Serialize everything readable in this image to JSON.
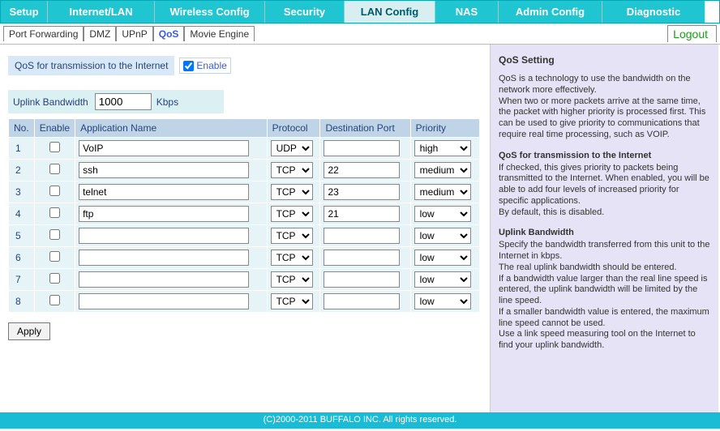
{
  "nav": {
    "setup": "Setup",
    "internet": "Internet/LAN",
    "wireless": "Wireless Config",
    "security": "Security",
    "lan": "LAN Config",
    "nas": "NAS",
    "admin": "Admin Config",
    "diagnostic": "Diagnostic"
  },
  "subnav": {
    "port_forwarding": "Port Forwarding",
    "dmz": "DMZ",
    "upnp": "UPnP",
    "qos": "QoS",
    "movie_engine": "Movie Engine",
    "logout": "Logout"
  },
  "qos": {
    "section_label": "QoS for transmission to the Internet",
    "enable_label": "Enable",
    "uplink_label": "Uplink Bandwidth",
    "uplink_value": "1000",
    "uplink_unit": "Kbps",
    "cols": {
      "no": "No.",
      "enable": "Enable",
      "app": "Application Name",
      "proto": "Protocol",
      "port": "Destination Port",
      "prio": "Priority"
    },
    "rows": [
      {
        "no": "1",
        "app": "VoIP",
        "proto": "UDP",
        "port": "",
        "prio": "high"
      },
      {
        "no": "2",
        "app": "ssh",
        "proto": "TCP",
        "port": "22",
        "prio": "medium"
      },
      {
        "no": "3",
        "app": "telnet",
        "proto": "TCP",
        "port": "23",
        "prio": "medium"
      },
      {
        "no": "4",
        "app": "ftp",
        "proto": "TCP",
        "port": "21",
        "prio": "low"
      },
      {
        "no": "5",
        "app": "",
        "proto": "TCP",
        "port": "",
        "prio": "low"
      },
      {
        "no": "6",
        "app": "",
        "proto": "TCP",
        "port": "",
        "prio": "low"
      },
      {
        "no": "7",
        "app": "",
        "proto": "TCP",
        "port": "",
        "prio": "low"
      },
      {
        "no": "8",
        "app": "",
        "proto": "TCP",
        "port": "",
        "prio": "low"
      }
    ],
    "apply": "Apply"
  },
  "help": {
    "title": "QoS Setting",
    "intro1": "QoS is a technology to use the bandwidth on the network more effectively.",
    "intro2": "When two or more packets arrive at the same time, the packet with higher priority is processed first. This can be used to give priority to communications that require real time processing, such as VOIP.",
    "h1": "QoS for transmission to the Internet",
    "p1": "If checked, this gives priority to packets being transmitted to the Internet. When enabled, you will be able to add four levels of increased priority for specific applications.",
    "p1b": "By default, this is disabled.",
    "h2": "Uplink Bandwidth",
    "p2": "Specify the bandwidth transferred from this unit to the Internet in kbps.",
    "p2b": "The real uplink bandwidth should be entered.",
    "p2c": "If a bandwidth value larger than the real line speed is entered, the uplink bandwidth will be limited by the line speed.",
    "p2d": "If a smaller bandwidth value is entered, the maximum line speed cannot be used.",
    "p2e": "Use a link speed measuring tool on the Internet to find your uplink bandwidth."
  },
  "footer": "(C)2000-2011 BUFFALO INC. All rights reserved."
}
